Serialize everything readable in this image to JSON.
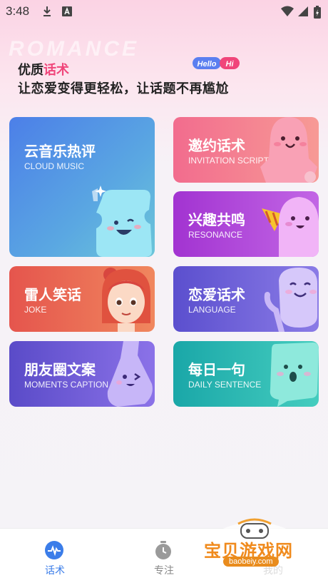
{
  "status": {
    "time": "3:48",
    "icons": [
      "download-icon",
      "font-a-icon",
      "wifi-icon",
      "signal-icon",
      "battery-charging-icon"
    ]
  },
  "header": {
    "watermark": "ROMANCE",
    "badge_hello": "Hello",
    "badge_hi": "Hi",
    "headline_prefix": "优质",
    "headline_accent": "话术",
    "subline": "让恋爱变得更轻松，让话题不再尴尬"
  },
  "cards": {
    "cloud": {
      "title": "云音乐热评",
      "subtitle": "CLOUD MUSIC"
    },
    "invite": {
      "title": "邀约话术",
      "subtitle": "INVITATION SCRIPT"
    },
    "resonance": {
      "title": "兴趣共鸣",
      "subtitle": "RESONANCE"
    },
    "joke": {
      "title": "雷人笑话",
      "subtitle": "JOKE"
    },
    "language": {
      "title": "恋爱话术",
      "subtitle": "LANGUAGE"
    },
    "moments": {
      "title": "朋友圈文案",
      "subtitle": "MOMENTS CAPTION"
    },
    "daily": {
      "title": "每日一句",
      "subtitle": "DAILY SENTENCE"
    }
  },
  "tabs": [
    {
      "label": "话术",
      "active": true
    },
    {
      "label": "专注",
      "active": false
    },
    {
      "label": "我的",
      "active": false
    }
  ],
  "overlay": {
    "site": "宝贝游戏网",
    "url": "baobeiy.com"
  },
  "colors": {
    "accent": "#f0457a",
    "tab_active": "#3b7de9",
    "tab_inactive": "#888888"
  }
}
